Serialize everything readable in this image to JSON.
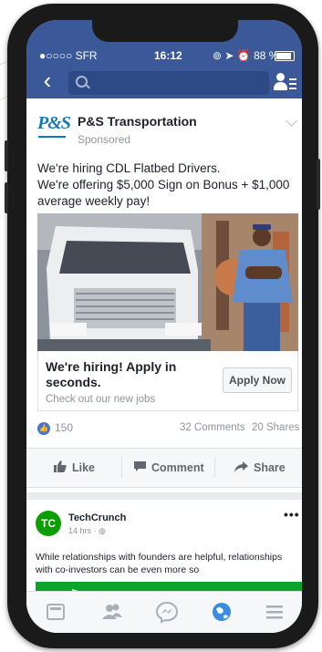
{
  "colors": {
    "facebook_blue": "#3b5998",
    "link_blue": "#4c73d0",
    "text_dark": "#1d2129",
    "text_gray": "#90949c",
    "techcrunch_green": "#0a9e01",
    "ps_blue": "#1479b8"
  },
  "status_bar": {
    "carrier": "●○○○○ SFR",
    "time": "16:12",
    "battery": "88 %"
  },
  "top_nav": {
    "back_icon": "chevron-left-icon",
    "search_icon": "search-icon",
    "search_value": "",
    "friends_icon": "friend-list-icon"
  },
  "ad_post": {
    "logo_text": "P&S",
    "author": "P&S Transportation",
    "sponsored_label": "Sponsored",
    "text_lines": [
      "We're hiring CDL Flatbed Drivers.",
      "We're offering $5,000 Sign on Bonus + $1,000",
      "average weekly pay!"
    ],
    "cta_title": "We're hiring! Apply in seconds.",
    "cta_subtitle": "Check out our new jobs",
    "cta_button": "Apply Now",
    "reactions_count": "150",
    "comments_count": "32 Comments",
    "shares_count": "20 Shares",
    "actions": {
      "like": "Like",
      "comment": "Comment",
      "share": "Share"
    }
  },
  "second_post": {
    "logo_text": "TC",
    "author": "TechCrunch",
    "time": "14 hrs · ",
    "more": "•••",
    "text_lines": [
      "While relationships with founders are helpful, relationships",
      "with co-investors can be even more so"
    ]
  },
  "tab_bar": {
    "items": [
      "news-feed-icon",
      "friends-icon",
      "messenger-icon",
      "notifications-globe-icon",
      "menu-icon"
    ],
    "active": "notifications-globe-icon"
  }
}
